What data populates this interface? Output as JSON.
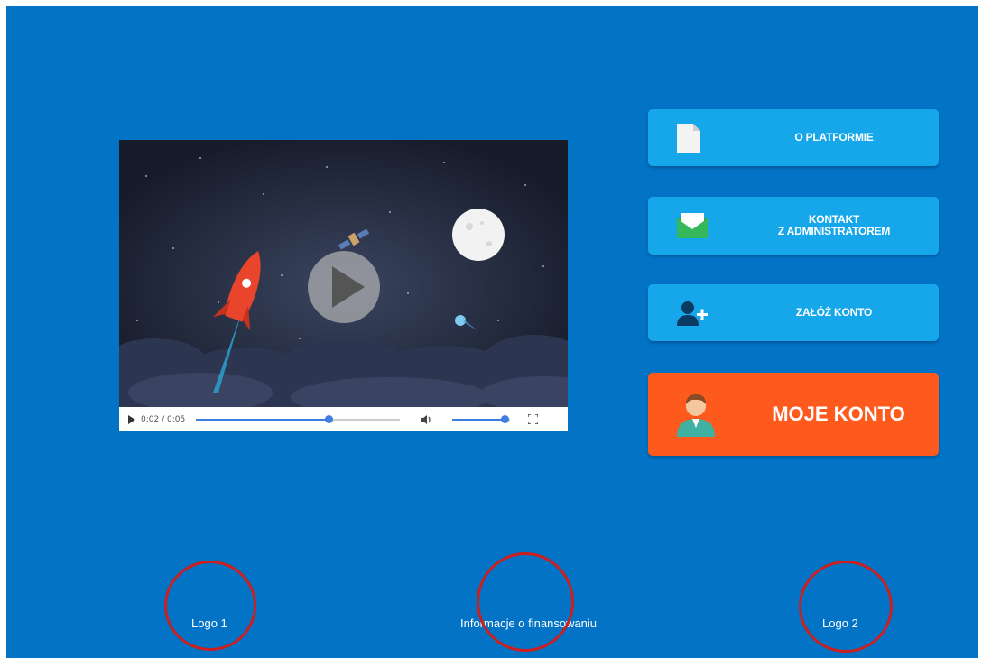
{
  "video": {
    "time": "0:02 / 0:05",
    "progress": 0.65,
    "volume": 0.9
  },
  "buttons": {
    "about": {
      "label": "O PLATFORMIE",
      "icon": "document-icon"
    },
    "contact": {
      "label_line1": "KONTAKT",
      "label_line2": "Z ADMINISTRATOREM",
      "icon": "envelope-icon"
    },
    "register": {
      "label": "ZAŁÓŻ KONTO",
      "icon": "add-user-icon"
    },
    "account": {
      "label": "MOJE KONTO",
      "icon": "user-avatar-icon"
    }
  },
  "footer": {
    "logo1": "Logo 1",
    "funding": "Informacje o finansowaniu",
    "logo2": "Logo 2"
  },
  "colors": {
    "background": "#0373c6",
    "button_blue": "#16a7ea",
    "button_orange": "#fe5a1d",
    "annotation_red": "#cc1f1f"
  }
}
